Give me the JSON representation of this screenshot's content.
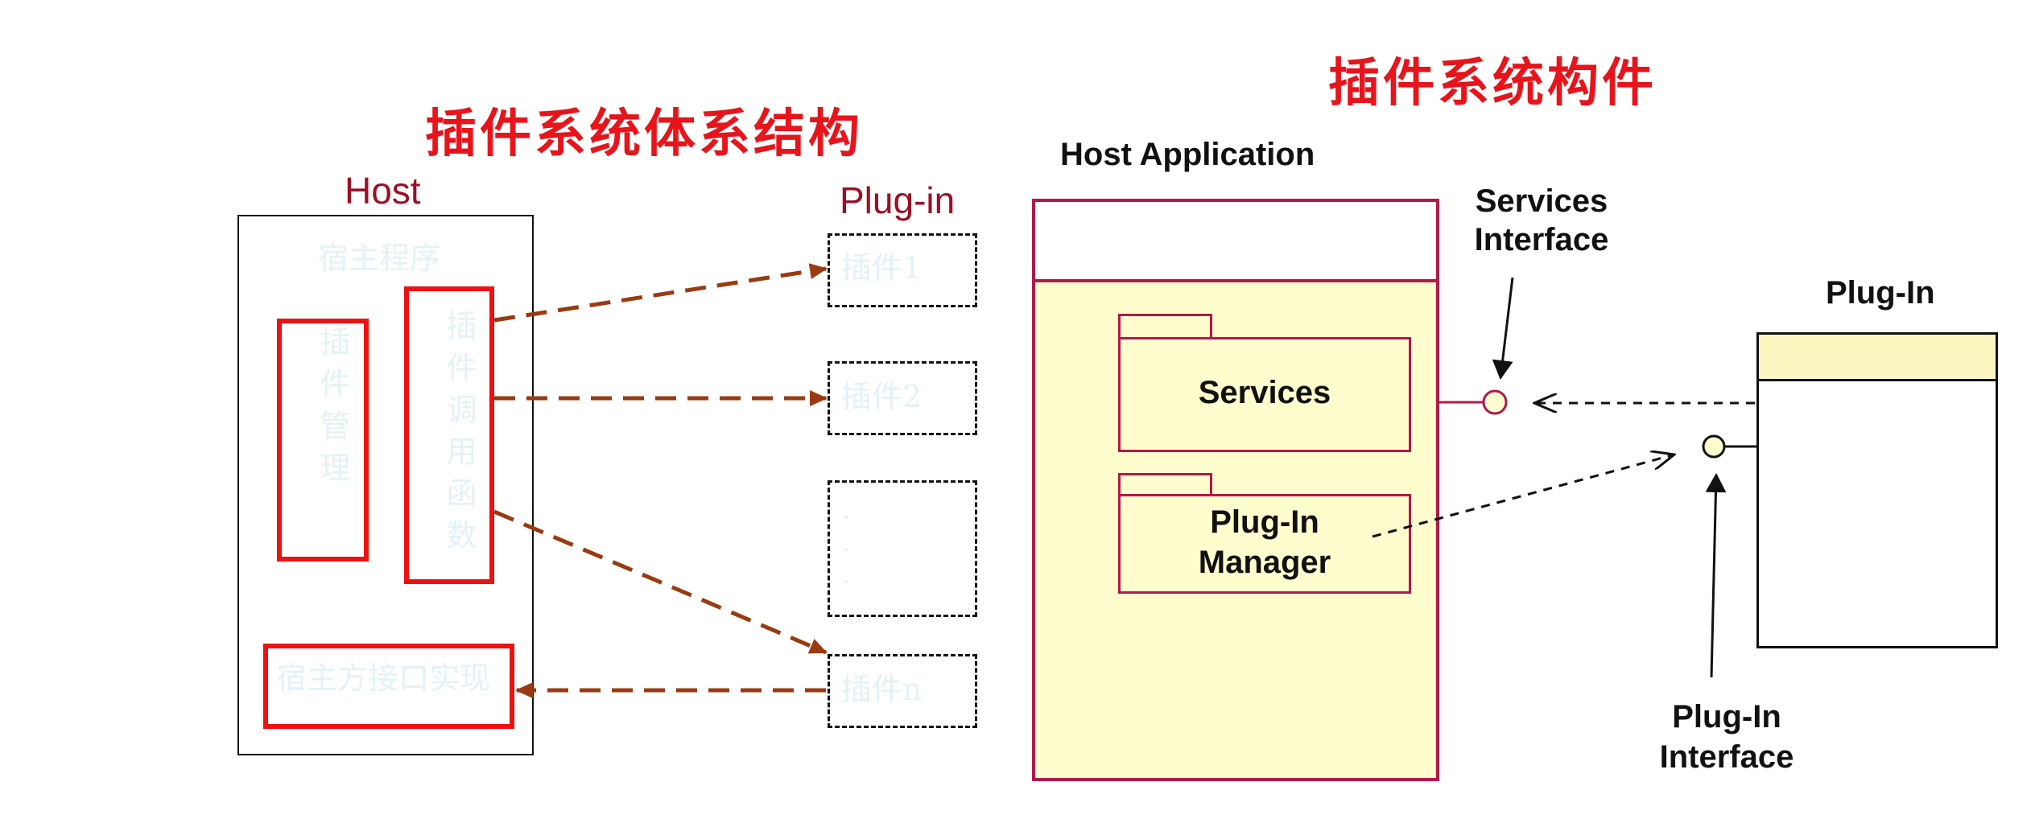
{
  "left": {
    "title": "插件系统体系结构",
    "host_label": "Host",
    "plugin_label": "Plug-in",
    "host_program": "宿主程序",
    "plugin_manage": "插件管理",
    "plugin_call": "插件调用函数",
    "host_interface": "宿主方接口实现",
    "plugins": [
      "插件1",
      "插件2",
      "插件n"
    ],
    "ellipsis": "·\n·\n·"
  },
  "right": {
    "title": "插件系统构件",
    "host_app": "Host Application",
    "services": "Services",
    "plugin_manager": "Plug-In\nManager",
    "services_interface": "Services\nInterface",
    "plugin": "Plug-In",
    "plugin_interface": "Plug-In\nInterface"
  },
  "colors": {
    "title_red": "#e8141b",
    "maroon": "#9b1025",
    "arrow_brown": "#9a3a10",
    "host_border": "#b01a4a",
    "host_fill": "#fffcce",
    "plugin_header": "#fbf5c0"
  }
}
